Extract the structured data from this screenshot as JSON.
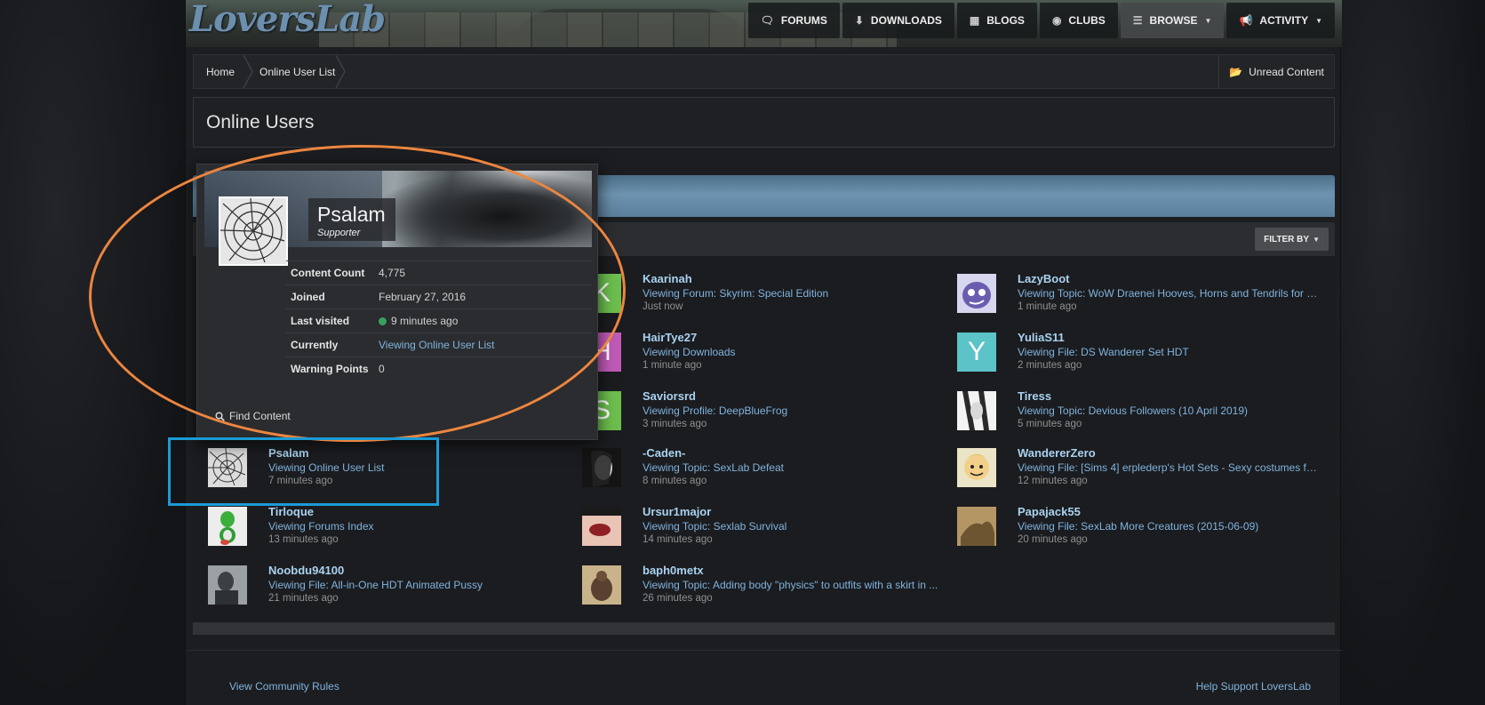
{
  "logo": "LoversLab",
  "nav": {
    "forums": "FORUMS",
    "downloads": "DOWNLOADS",
    "blogs": "BLOGS",
    "clubs": "CLUBS",
    "browse": "BROWSE",
    "activity": "ACTIVITY"
  },
  "breadcrumb": {
    "home": "Home",
    "current": "Online User List"
  },
  "unread_content": "Unread Content",
  "page_title": "Online Users",
  "filter_by": "FILTER BY",
  "hovercard": {
    "name": "Psalam",
    "group": "Supporter",
    "rows": [
      {
        "label": "Content Count",
        "value": "4,775"
      },
      {
        "label": "Joined",
        "value": "February 27, 2016"
      },
      {
        "label": "Last visited",
        "value": "9 minutes ago"
      },
      {
        "label": "Currently",
        "value": "Viewing Online User List"
      },
      {
        "label": "Warning Points",
        "value": "0"
      }
    ],
    "find_content": "Find Content"
  },
  "users": {
    "col1": [
      {
        "name": "Psalam",
        "activity": "Viewing Online User List",
        "time": "7 minutes ago"
      },
      {
        "name": "Tirloque",
        "activity": "Viewing Forums Index",
        "time": "13 minutes ago"
      },
      {
        "name": "Noobdu94100",
        "activity": "Viewing File: All-in-One HDT Animated Pussy",
        "time": "21 minutes ago"
      }
    ],
    "col2": [
      {
        "name": "Kaarinah",
        "activity": "Viewing Forum: Skyrim: Special Edition",
        "time": "Just now",
        "letter": "K",
        "color": "#6cbf4e"
      },
      {
        "name": "HairTye27",
        "activity": "Viewing Downloads",
        "time": "1 minute ago",
        "letter": "H",
        "color": "#c05bb8"
      },
      {
        "name": "Saviorsrd",
        "activity": "Viewing Profile: DeepBlueFrog",
        "time": "3 minutes ago",
        "letter": "S",
        "color": "#6cbf4e"
      },
      {
        "name": "-Caden-",
        "activity": "Viewing Topic: SexLab Defeat",
        "time": "8 minutes ago"
      },
      {
        "name": "Ursur1major",
        "activity": "Viewing Topic: Sexlab Survival",
        "time": "14 minutes ago"
      },
      {
        "name": "baph0metx",
        "activity": "Viewing Topic: Adding body \"physics\" to outfits with a skirt in ...",
        "time": "26 minutes ago"
      }
    ],
    "col3": [
      {
        "name": "LazyBoot",
        "activity": "Viewing Topic: WoW Draenei Hooves, Horns and Tendrils for S...",
        "time": "1 minute ago"
      },
      {
        "name": "YuliaS11",
        "activity": "Viewing File: DS Wanderer Set HDT",
        "time": "2 minutes ago",
        "letter": "Y",
        "color": "#5cc3c8"
      },
      {
        "name": "Tiress",
        "activity": "Viewing Topic: Devious Followers (10 April 2019)",
        "time": "5 minutes ago"
      },
      {
        "name": "WandererZero",
        "activity": "Viewing File: [Sims 4] erplederp's Hot Sets - Sexy costumes fo...",
        "time": "12 minutes ago"
      },
      {
        "name": "Papajack55",
        "activity": "Viewing File: SexLab More Creatures (2015-06-09)",
        "time": "20 minutes ago"
      }
    ]
  },
  "footer": {
    "left": "View Community Rules",
    "right": "Help Support LoversLab"
  },
  "colors": {
    "link": "#7fb3df",
    "username": "#a9d2f0",
    "annotation_orange": "#ec8640",
    "annotation_blue": "#1b9bd7"
  }
}
